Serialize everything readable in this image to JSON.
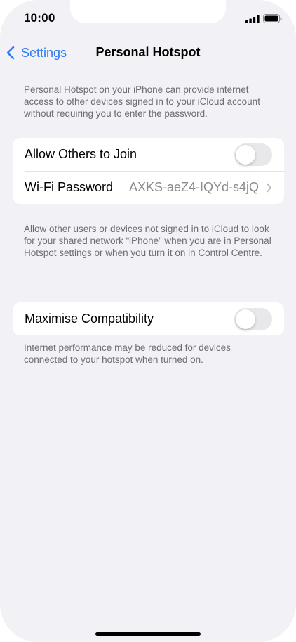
{
  "status_bar": {
    "time": "10:00",
    "signal_icon": "signal-bars-icon",
    "battery_icon": "battery-icon"
  },
  "nav": {
    "back_label": "Settings",
    "title": "Personal Hotspot"
  },
  "intro_note": "Personal Hotspot on your iPhone can provide internet access to other devices signed in to your iCloud account without requiring you to enter the password.",
  "group1": {
    "allow_label": "Allow Others to Join",
    "allow_enabled": false,
    "wifi_label": "Wi-Fi Password",
    "wifi_value": "AXKS-aeZ4-IQYd-s4jQ"
  },
  "group1_note": "Allow other users or devices not signed in to iCloud to look for your shared network “iPhone” when you are in Personal Hotspot settings or when you turn it on in Control Centre.",
  "group2": {
    "compat_label": "Maximise Compatibility",
    "compat_enabled": false
  },
  "group2_note": "Internet performance may be reduced for devices connected to your hotspot when turned on.",
  "colors": {
    "accent": "#2f7cf6",
    "background": "#f2f1f6",
    "secondary_text": "#6d6d72"
  }
}
